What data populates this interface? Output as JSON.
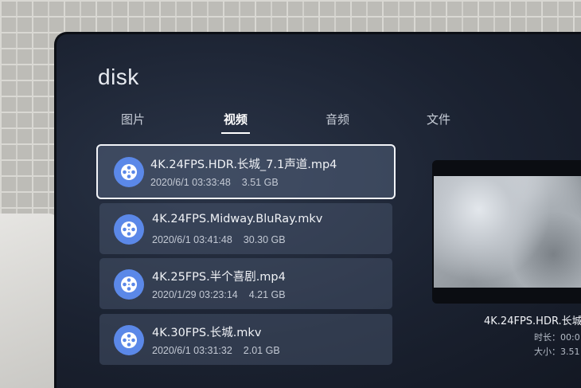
{
  "app": {
    "title": "disk"
  },
  "tabs": [
    {
      "label": "图片",
      "active": false
    },
    {
      "label": "视频",
      "active": true
    },
    {
      "label": "音频",
      "active": false
    },
    {
      "label": "文件",
      "active": false
    }
  ],
  "files": [
    {
      "name": "4K.24FPS.HDR.长城_7.1声道.mp4",
      "date": "2020/6/1 03:33:48",
      "size": "3.51 GB",
      "selected": true,
      "icon": "video-reel-icon"
    },
    {
      "name": "4K.24FPS.Midway.BluRay.mkv",
      "date": "2020/6/1 03:41:48",
      "size": "30.30 GB",
      "selected": false,
      "icon": "video-reel-icon"
    },
    {
      "name": "4K.25FPS.半个喜剧.mp4",
      "date": "2020/1/29 03:23:14",
      "size": "4.21 GB",
      "selected": false,
      "icon": "video-reel-icon"
    },
    {
      "name": "4K.30FPS.长城.mkv",
      "date": "2020/6/1 03:31:32",
      "size": "2.01 GB",
      "selected": false,
      "icon": "video-reel-icon"
    }
  ],
  "preview": {
    "title": "4K.24FPS.HDR.长城",
    "duration": "时长：00:0",
    "size": "大小：3.51"
  },
  "colors": {
    "icon_bg": "#5b88e8",
    "screen_bg": "#1b2231",
    "focus_border": "#f2f4f8"
  }
}
